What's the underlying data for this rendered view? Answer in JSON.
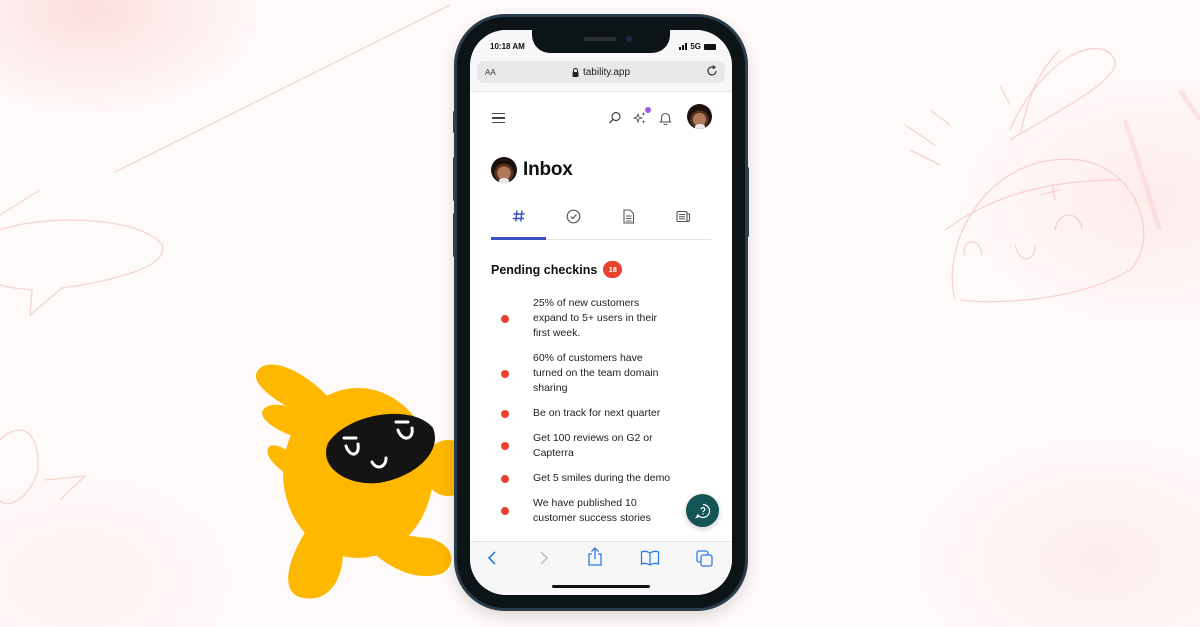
{
  "status_bar": {
    "time": "10:18 AM",
    "network": "5G"
  },
  "browser": {
    "text_size_label": "AA",
    "url": "tability.app",
    "icons": {
      "lock": "lock-icon",
      "reload": "reload-icon",
      "back": "chevron-left-icon",
      "forward": "chevron-right-icon",
      "share": "share-icon",
      "bookmarks": "book-icon",
      "tabs": "tabs-icon"
    }
  },
  "app": {
    "nav_icons": [
      "menu-icon",
      "search-icon",
      "sparkles-icon",
      "bell-icon",
      "avatar"
    ],
    "page_title": "Inbox",
    "tabs": [
      {
        "name": "hashtag-icon",
        "active": true
      },
      {
        "name": "check-circle-icon",
        "active": false
      },
      {
        "name": "document-icon",
        "active": false
      },
      {
        "name": "newspaper-icon",
        "active": false
      }
    ],
    "section_title": "Pending checkins",
    "pending_count": "18",
    "checkins": [
      "25% of new customers expand to 5+ users in their first week.",
      "60% of customers have turned on the team domain sharing",
      "Be on track for next quarter",
      "Get 100 reviews on G2 or Capterra",
      "Get 5 smiles during the demo",
      "We have published 10 customer success stories"
    ],
    "help_button": "help-chat-icon"
  },
  "colors": {
    "accent": "#3b4fc4",
    "badge": "#e8432e",
    "notification_dot": "#9b5de5",
    "help_fab": "#145556",
    "mascot": "#ffb800",
    "browser_link": "#2f7de1"
  }
}
